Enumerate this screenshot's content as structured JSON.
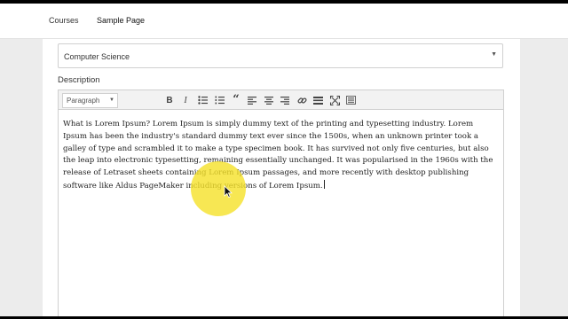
{
  "nav": {
    "items": [
      {
        "label": "Courses"
      },
      {
        "label": "Sample Page"
      }
    ]
  },
  "form": {
    "category_select": {
      "value": "Computer Science"
    },
    "description_label": "Description"
  },
  "editor": {
    "toolbar": {
      "format_select": "Paragraph",
      "buttons": [
        "bold-icon",
        "italic-icon",
        "bullet-list-icon",
        "numbered-list-icon",
        "blockquote-icon",
        "align-left-icon",
        "align-center-icon",
        "align-right-icon",
        "link-icon",
        "horizontal-line-icon",
        "fullscreen-icon",
        "toolbar-toggle-icon"
      ]
    },
    "content": "What is Lorem Ipsum? Lorem Ipsum is simply dummy text of the printing and typesetting industry. Lorem Ipsum has been the industry's standard dummy text ever since the 1500s, when an unknown printer took a galley of type and scrambled it to make a type specimen book. It has survived not only five centuries, but also the leap into electronic typesetting, remaining essentially unchanged. It was popularised in the 1960s with the release of Letraset sheets containing Lorem Ipsum passages, and more recently with desktop publishing software like Aldus PageMaker including versions of Lorem Ipsum."
  },
  "colors": {
    "highlight": "#f5e128",
    "page_background": "#ececec",
    "panel": "#ffffff"
  }
}
